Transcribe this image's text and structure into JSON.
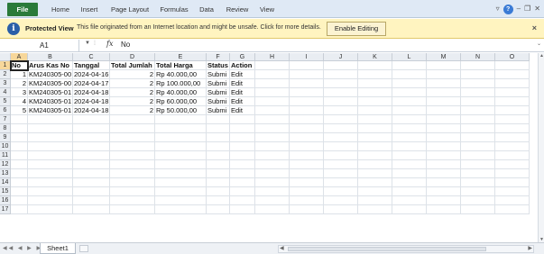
{
  "ribbon": {
    "file_tab": "File",
    "tabs": [
      "Home",
      "Insert",
      "Page Layout",
      "Formulas",
      "Data",
      "Review",
      "View"
    ],
    "icons": [
      "minimize-ribbon-icon",
      "help-icon",
      "minimize-window-icon",
      "restore-window-icon",
      "close-window-icon"
    ]
  },
  "protected_view": {
    "title": "Protected View",
    "message": "This file originated from an Internet location and might be unsafe. Click for more details.",
    "button": "Enable Editing",
    "close": "×"
  },
  "formula_bar": {
    "name_box": "A1",
    "fx": "fx",
    "content": "No"
  },
  "columns": [
    "A",
    "B",
    "C",
    "D",
    "E",
    "F",
    "G",
    "H",
    "I",
    "J",
    "K",
    "L",
    "M",
    "N",
    "O"
  ],
  "rows": [
    "1",
    "2",
    "3",
    "4",
    "5",
    "6",
    "7",
    "8",
    "9",
    "10",
    "11",
    "12",
    "13",
    "14",
    "15",
    "16",
    "17"
  ],
  "table": {
    "headers": [
      "No",
      "Arus Kas No",
      "Tanggal",
      "Total Jumlah",
      "Total Harga",
      "Status",
      "Action"
    ],
    "rows": [
      [
        "1",
        "KM240305-00",
        "2024-04-16",
        "2",
        "Rp 40.000,00",
        "Submi",
        "Edit"
      ],
      [
        "2",
        "KM240305-00",
        "2024-04-17",
        "2",
        "Rp 100.000,00",
        "Submi",
        "Edit"
      ],
      [
        "3",
        "KM240305-01",
        "2024-04-18",
        "2",
        "Rp 40.000,00",
        "Submi",
        "Edit"
      ],
      [
        "4",
        "KM240305-01",
        "2024-04-18",
        "2",
        "Rp 60.000,00",
        "Submi",
        "Edit"
      ],
      [
        "5",
        "KM240305-01",
        "2024-04-18",
        "2",
        "Rp 50.000,00",
        "Submi",
        "Edit"
      ]
    ]
  },
  "sheets": [
    "Sheet1"
  ],
  "colors": {
    "ribbon_bg": "#dfe9f5",
    "file_tab": "#2a7a3a",
    "protected_bar": "#fff4c0",
    "selection_header": "#f7d79a"
  }
}
